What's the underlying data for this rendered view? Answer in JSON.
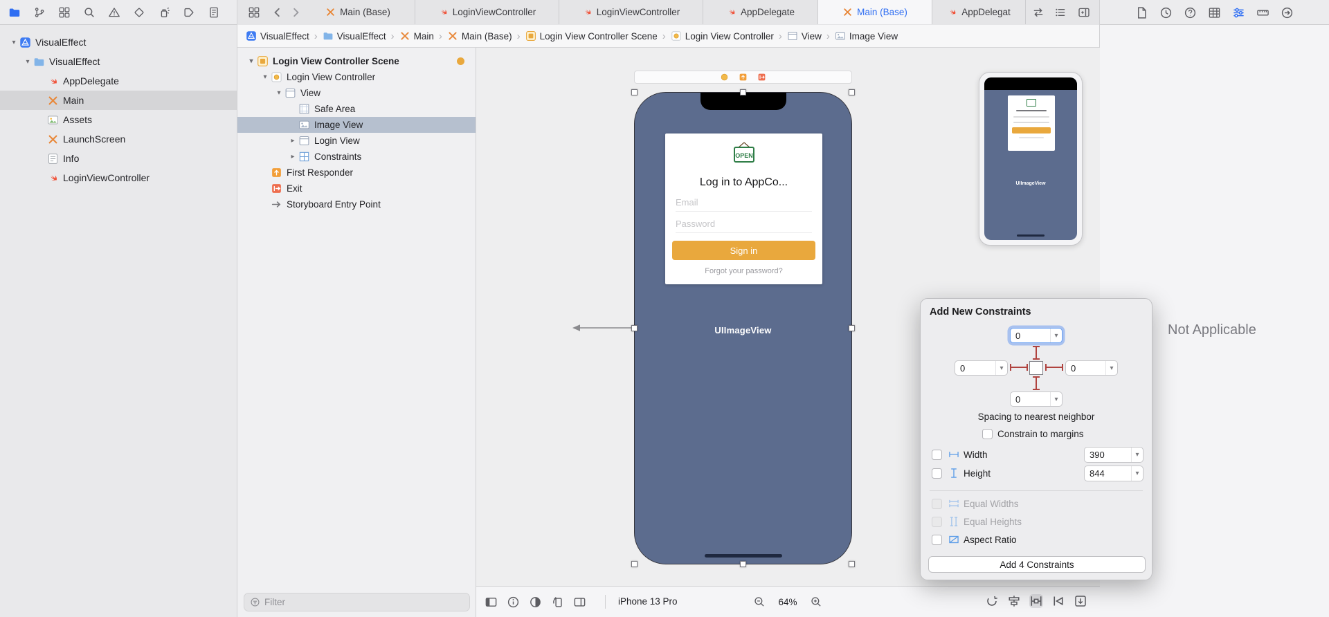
{
  "colors": {
    "accent_blue": "#2F6EF2",
    "swift_orange": "#F05138",
    "storyboard_orange": "#E8883A",
    "scene_yellow": "#E9A83D",
    "sign_in_orange": "#E9A83D",
    "phone_slate": "#5C6C8E",
    "constraint_red": "#B0433F",
    "navigator_selection": "#D5D5D7",
    "outline_selection": "#B6C0CF"
  },
  "topbar": {
    "tabs": [
      {
        "label": "Main (Base)",
        "icon": "storyboard"
      },
      {
        "label": "LoginViewController",
        "icon": "swift"
      },
      {
        "label": "LoginViewController",
        "icon": "swift"
      },
      {
        "label": "AppDelegate",
        "icon": "swift"
      },
      {
        "label": "Main (Base)",
        "icon": "storyboard"
      },
      {
        "label": "AppDelegat",
        "icon": "swift"
      }
    ]
  },
  "breadcrumb": {
    "items": [
      {
        "label": "VisualEffect",
        "icon": "project-icon"
      },
      {
        "label": "VisualEffect",
        "icon": "folder-icon"
      },
      {
        "label": "Main",
        "icon": "storyboard-icon"
      },
      {
        "label": "Main (Base)",
        "icon": "storyboard-icon"
      },
      {
        "label": "Login View Controller Scene",
        "icon": "scene-icon"
      },
      {
        "label": "Login View Controller",
        "icon": "view-controller-icon"
      },
      {
        "label": "View",
        "icon": "view-icon"
      },
      {
        "label": "Image View",
        "icon": "image-view-icon"
      }
    ]
  },
  "navigator": {
    "items": [
      {
        "label": "VisualEffect",
        "icon": "project-icon"
      },
      {
        "label": "VisualEffect",
        "icon": "folder-icon"
      },
      {
        "label": "AppDelegate",
        "icon": "swift-icon"
      },
      {
        "label": "Main",
        "icon": "storyboard-icon",
        "selected": true
      },
      {
        "label": "Assets",
        "icon": "assets-icon"
      },
      {
        "label": "LaunchScreen",
        "icon": "storyboard-icon"
      },
      {
        "label": "Info",
        "icon": "plist-icon"
      },
      {
        "label": "LoginViewController",
        "icon": "swift-icon"
      }
    ]
  },
  "outline": {
    "items": [
      {
        "label": "Login View Controller Scene",
        "icon": "scene-icon"
      },
      {
        "label": "Login View Controller",
        "icon": "view-controller-icon"
      },
      {
        "label": "View",
        "icon": "view-icon"
      },
      {
        "label": "Safe Area",
        "icon": "safe-area-icon"
      },
      {
        "label": "Image View",
        "icon": "image-view-icon",
        "selected": true
      },
      {
        "label": "Login View",
        "icon": "view-icon"
      },
      {
        "label": "Constraints",
        "icon": "constraints-icon"
      },
      {
        "label": "First Responder",
        "icon": "first-responder-icon"
      },
      {
        "label": "Exit",
        "icon": "exit-icon"
      },
      {
        "label": "Storyboard Entry Point",
        "icon": "entry-point-icon"
      }
    ],
    "filter_placeholder": "Filter"
  },
  "canvas": {
    "login_screen": {
      "sign_text": "OPEN",
      "title": "Log in to AppCo...",
      "email_placeholder": "Email",
      "password_placeholder": "Password",
      "sign_in_label": "Sign in",
      "forgot_label": "Forgot your password?"
    },
    "selected_view_label": "UIImageView"
  },
  "popover": {
    "title": "Add New Constraints",
    "top_value": "0",
    "leading_value": "0",
    "trailing_value": "0",
    "bottom_value": "0",
    "spacing_label": "Spacing to nearest neighbor",
    "constrain_margins_label": "Constrain to margins",
    "width_label": "Width",
    "width_value": "390",
    "height_label": "Height",
    "height_value": "844",
    "equal_widths_label": "Equal Widths",
    "equal_heights_label": "Equal Heights",
    "aspect_ratio_label": "Aspect Ratio",
    "add_button_label": "Add 4 Constraints"
  },
  "inspector": {
    "empty_message": "Not Applicable"
  },
  "statusbar": {
    "device_name": "iPhone 13 Pro",
    "zoom_level": "64%"
  }
}
